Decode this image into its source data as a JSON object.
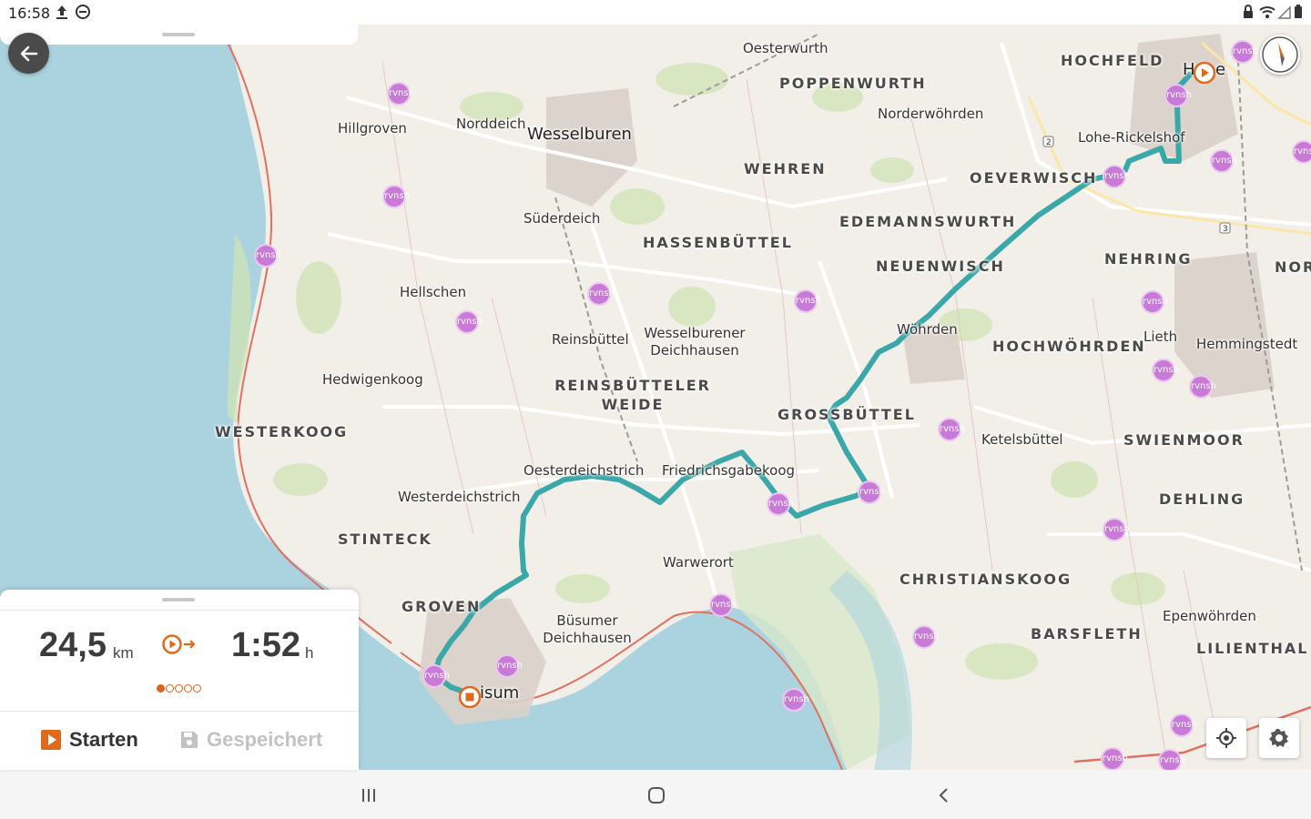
{
  "status_bar": {
    "time": "16:58",
    "icons_left": [
      "upload-icon",
      "do-not-disturb-icon"
    ],
    "icons_right": [
      "lock-icon",
      "wifi-icon",
      "signal-icon",
      "battery-icon"
    ]
  },
  "map": {
    "places": [
      {
        "name": "Oesterwurth",
        "kind": "village"
      },
      {
        "name": "POPPENWURTH",
        "kind": "district"
      },
      {
        "name": "HOCHFELD",
        "kind": "district"
      },
      {
        "name": "Norderwöhrden",
        "kind": "village"
      },
      {
        "name": "Hillgroven",
        "kind": "village"
      },
      {
        "name": "Norddeich",
        "kind": "village"
      },
      {
        "name": "Wesselburen",
        "kind": "town"
      },
      {
        "name": "Lohe-Rickelshof",
        "kind": "village"
      },
      {
        "name": "WEHREN",
        "kind": "district"
      },
      {
        "name": "OEVERWISCH",
        "kind": "district"
      },
      {
        "name": "Süderdeich",
        "kind": "village"
      },
      {
        "name": "EDEMANNSWURTH",
        "kind": "district"
      },
      {
        "name": "HASSENBÜTTEL",
        "kind": "district"
      },
      {
        "name": "NEHRING",
        "kind": "district"
      },
      {
        "name": "NOR",
        "kind": "district"
      },
      {
        "name": "NEUENWISCH",
        "kind": "district"
      },
      {
        "name": "Hellschen",
        "kind": "village"
      },
      {
        "name": "Wöhrden",
        "kind": "village"
      },
      {
        "name": "Wesselburener",
        "kind": "village"
      },
      {
        "name": "Deichhausen",
        "kind": "village"
      },
      {
        "name": "Reinsbüttel",
        "kind": "village"
      },
      {
        "name": "Lieth",
        "kind": "village"
      },
      {
        "name": "HOCHWÖHRDEN",
        "kind": "district"
      },
      {
        "name": "Hemmingstedt",
        "kind": "village"
      },
      {
        "name": "Hedwigenkoog",
        "kind": "village"
      },
      {
        "name": "REINSBÜTTELER",
        "kind": "district"
      },
      {
        "name": "WEIDE",
        "kind": "district"
      },
      {
        "name": "GROSSBÜTTEL",
        "kind": "district"
      },
      {
        "name": "WESTERKOOG",
        "kind": "district"
      },
      {
        "name": "Ketelsbüttel",
        "kind": "village"
      },
      {
        "name": "SWIENMOOR",
        "kind": "district"
      },
      {
        "name": "Oesterdeichstrich",
        "kind": "village"
      },
      {
        "name": "Friedrichsgabekoog",
        "kind": "village"
      },
      {
        "name": "Westerdeichstrich",
        "kind": "village"
      },
      {
        "name": "DEHLING",
        "kind": "district"
      },
      {
        "name": "STINTECK",
        "kind": "district"
      },
      {
        "name": "Warwerort",
        "kind": "village"
      },
      {
        "name": "CHRISTIANSKOOG",
        "kind": "district"
      },
      {
        "name": "GROVEN",
        "kind": "district"
      },
      {
        "name": "Epenwöhrden",
        "kind": "village"
      },
      {
        "name": "Büsumer",
        "kind": "village"
      },
      {
        "name": "Deichhausen",
        "kind": "village"
      },
      {
        "name": "BARSFLETH",
        "kind": "district"
      },
      {
        "name": "LILIENTHAL",
        "kind": "district"
      },
      {
        "name": "isum",
        "kind": "town"
      },
      {
        "name": "H",
        "kind": "town"
      },
      {
        "name": "e",
        "kind": "town"
      }
    ],
    "bus_stop_label": "rvnsh",
    "route_color": "#3aa7a8",
    "start_marker_color": "#e06a1b",
    "road_shields": [
      "2",
      "3"
    ]
  },
  "controls": {
    "back": "arrow-left-icon",
    "compass": "compass-icon",
    "locate": "locate-icon",
    "settings": "gear-icon"
  },
  "panel": {
    "distance_value": "24,5",
    "distance_unit": "km",
    "duration_value": "1:52",
    "duration_unit": "h",
    "difficulty_filled": 1,
    "difficulty_total": 5,
    "start_label": "Starten",
    "saved_label": "Gespeichert",
    "accent": "#e06a1b"
  },
  "nav_bar": {
    "recents": "recents-icon",
    "home": "home-icon",
    "back": "back-icon"
  }
}
